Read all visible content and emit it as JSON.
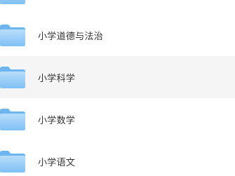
{
  "file_list": {
    "items": [
      {
        "label": "",
        "icon": "folder-icon",
        "partial": true
      },
      {
        "label": "小学道德与法治",
        "icon": "folder-icon"
      },
      {
        "label": "小学科学",
        "icon": "folder-icon",
        "selected": true
      },
      {
        "label": "小学数学",
        "icon": "folder-icon"
      },
      {
        "label": "小学语文",
        "icon": "folder-icon"
      }
    ]
  },
  "colors": {
    "folder_back": "#6eb4f0",
    "folder_front_top": "#b9ddfb",
    "folder_front_bottom": "#7fc0f4",
    "selected_row_bg": "#f5f5f5",
    "label_text": "#333333"
  }
}
